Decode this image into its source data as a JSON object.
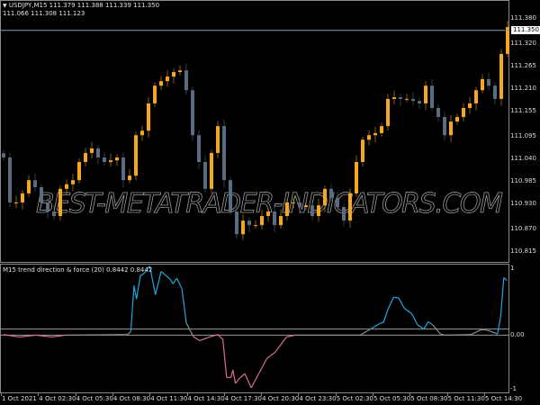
{
  "header": {
    "symbol_line": "USDJPY,M15  111.379 111.388 111.339 111.350",
    "ohlc_line2": "111.066 111.308 111.123"
  },
  "watermark": "BEST-METATRADER-INDICATORS.COM",
  "price_axis": {
    "ticks": [
      "111.380",
      "111.320",
      "111.265",
      "111.210",
      "111.155",
      "111.095",
      "111.040",
      "110.985",
      "110.930",
      "110.870",
      "110.815"
    ],
    "current_price": "111.350"
  },
  "indicator": {
    "label": "M15 trend direction & force (20) 0.8442 0.8442",
    "axis_ticks": [
      "1",
      "0.00",
      "-1"
    ],
    "colors": {
      "up": "#1ea7e0",
      "down": "#d9708c",
      "neutral": "#8c8c8c"
    }
  },
  "time_axis": [
    "1 Oct 2021",
    "4 Oct 02:30",
    "4 Oct 05:30",
    "4 Oct 08:30",
    "4 Oct 11:30",
    "4 Oct 14:30",
    "4 Oct 17:30",
    "4 Oct 20:30",
    "4 Oct 23:30",
    "5 Oct 02:30",
    "5 Oct 05:30",
    "5 Oct 08:30",
    "5 Oct 11:30",
    "5 Oct 14:30"
  ],
  "chart_data": [
    {
      "type": "candlestick",
      "colors": {
        "bull": "#f5a623",
        "bear": "#5b6b80"
      },
      "ylim": [
        110.79,
        111.42
      ],
      "closes": [
        111.042,
        110.933,
        110.933,
        110.955,
        110.987,
        110.97,
        110.933,
        110.911,
        110.9,
        110.966,
        110.977,
        110.987,
        111.031,
        111.053,
        111.064,
        111.042,
        111.031,
        111.035,
        111.042,
        110.987,
        110.998,
        111.096,
        111.107,
        111.173,
        111.216,
        111.227,
        111.238,
        111.249,
        111.253,
        111.205,
        111.096,
        111.031,
        110.966,
        111.053,
        111.118,
        110.987,
        110.911,
        110.856,
        110.889,
        110.878,
        110.878,
        110.9,
        110.911,
        110.878,
        110.9,
        110.933,
        110.933,
        110.922,
        110.926,
        110.9,
        110.926,
        110.966,
        110.944,
        110.922,
        110.889,
        110.955,
        111.031,
        111.085,
        111.096,
        111.101,
        111.118,
        111.184,
        111.188,
        111.184,
        111.184,
        111.179,
        111.173,
        111.216,
        111.162,
        111.14,
        111.096,
        111.129,
        111.14,
        111.162,
        111.173,
        111.205,
        111.232,
        111.216,
        111.184,
        111.293,
        111.358
      ]
    },
    {
      "type": "line",
      "ylim": [
        -1,
        1
      ],
      "levels": [
        0.05,
        -0.05
      ],
      "points": [
        [
          0,
          -0.04
        ],
        [
          2.5,
          -0.08
        ],
        [
          5.1,
          -0.05
        ],
        [
          7.7,
          -0.08
        ],
        [
          9.8,
          -0.05
        ],
        [
          19.7,
          -0.04
        ],
        [
          20.2,
          0.01
        ],
        [
          20.7,
          0.76
        ],
        [
          21.1,
          0.54
        ],
        [
          21.7,
          0.92
        ],
        [
          22.3,
          0.96
        ],
        [
          23.2,
          1.08
        ],
        [
          24.1,
          0.61
        ],
        [
          25.0,
          0.99
        ],
        [
          26.4,
          0.87
        ],
        [
          26.9,
          0.79
        ],
        [
          27.5,
          0.88
        ],
        [
          28.3,
          0.71
        ],
        [
          29.0,
          0.15
        ],
        [
          30.1,
          -0.07
        ],
        [
          31.1,
          -0.14
        ],
        [
          32.7,
          -0.08
        ],
        [
          34.0,
          -0.04
        ],
        [
          34.8,
          -0.12
        ],
        [
          35.4,
          -0.74
        ],
        [
          36.1,
          -0.74
        ],
        [
          36.4,
          -0.62
        ],
        [
          36.8,
          -0.84
        ],
        [
          37.4,
          -0.76
        ],
        [
          38.3,
          -0.68
        ],
        [
          39.3,
          -0.91
        ],
        [
          40.5,
          -0.68
        ],
        [
          41.8,
          -0.43
        ],
        [
          43.1,
          -0.33
        ],
        [
          44.9,
          -0.08
        ],
        [
          46.2,
          -0.05
        ],
        [
          56.6,
          -0.05
        ],
        [
          58.1,
          0.04
        ],
        [
          59.7,
          0.14
        ],
        [
          60.3,
          0.16
        ],
        [
          61.0,
          0.37
        ],
        [
          61.9,
          0.57
        ],
        [
          62.7,
          0.56
        ],
        [
          63.6,
          0.39
        ],
        [
          64.8,
          0.3
        ],
        [
          65.7,
          0.12
        ],
        [
          66.7,
          0.05
        ],
        [
          67.4,
          0.17
        ],
        [
          68.1,
          0.12
        ],
        [
          69.3,
          -0.03
        ],
        [
          70.1,
          -0.05
        ],
        [
          74.2,
          -0.04
        ],
        [
          75.8,
          0.04
        ],
        [
          76.8,
          0.03
        ],
        [
          78.4,
          -0.03
        ],
        [
          78.9,
          0.25
        ],
        [
          79.4,
          0.89
        ],
        [
          79.9,
          0.8442
        ]
      ]
    }
  ]
}
